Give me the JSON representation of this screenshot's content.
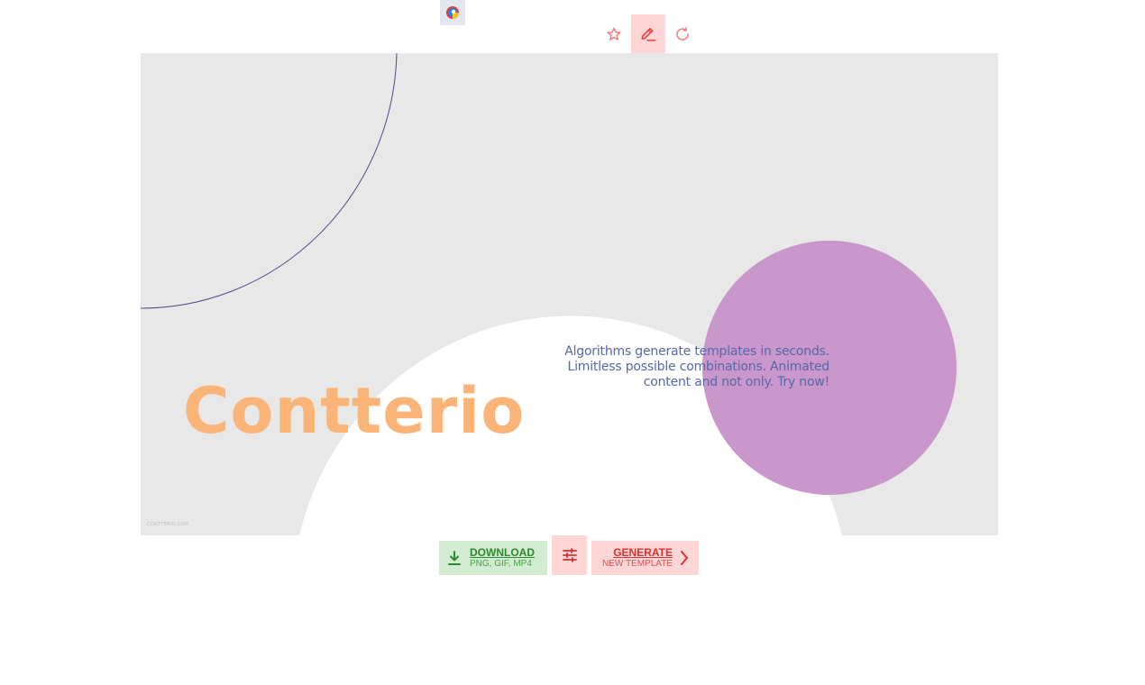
{
  "app_badge": {
    "icon": "app-logo-icon"
  },
  "toolbar": {
    "items": [
      {
        "icon": "star-icon",
        "active": false
      },
      {
        "icon": "edit-icon",
        "active": true
      },
      {
        "icon": "refresh-icon",
        "active": false
      }
    ]
  },
  "template": {
    "title": "Contterio",
    "tagline": "Algorithms generate templates in seconds. Limitless possible combinations. Animated content and not only. Try now!",
    "watermark": "CONTTERIO.COM",
    "colors": {
      "background": "#e8e8e8",
      "title": "#fbb478",
      "tagline": "#5668a8",
      "circle": "#c997cb",
      "arc_stroke": "#4a4a8a",
      "white_shape": "#ffffff"
    }
  },
  "actions": {
    "download": {
      "label": "DOWNLOAD",
      "sublabel": "PNG, GIF, MP4",
      "icon": "download-icon"
    },
    "settings": {
      "icon": "sliders-icon"
    },
    "generate": {
      "label": "GENERATE",
      "sublabel": "NEW TEMPLATE",
      "icon": "chevron-right-icon"
    }
  }
}
